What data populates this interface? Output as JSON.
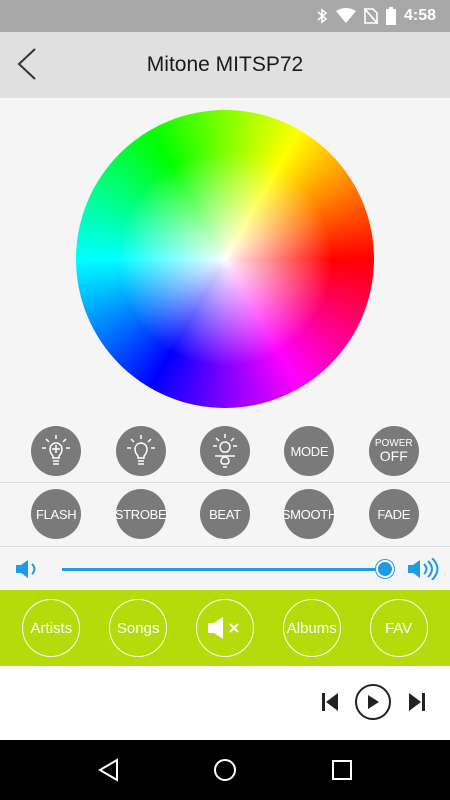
{
  "status_bar": {
    "time": "4:58",
    "icons": [
      "bluetooth-icon",
      "wifi-icon",
      "no-sim-icon",
      "battery-icon"
    ]
  },
  "header": {
    "title": "Mitone MITSP72",
    "back_icon": "chevron-left-icon"
  },
  "color_wheel": {
    "colors": [
      "#ff0000",
      "#ff00ff",
      "#0000ff",
      "#00ffff",
      "#00ff00",
      "#ffff00"
    ]
  },
  "controls_row1": [
    {
      "icon": "bulb-brightness-up-icon"
    },
    {
      "icon": "bulb-brightness-down-icon"
    },
    {
      "icon": "bulb-lamp-icon"
    },
    {
      "label": "MODE"
    },
    {
      "label_top": "POWER",
      "label_bottom": "OFF"
    }
  ],
  "controls_row2": [
    {
      "label": "FLASH"
    },
    {
      "label": "STROBE"
    },
    {
      "label": "BEAT"
    },
    {
      "label": "SMOOTH"
    },
    {
      "label": "FADE"
    }
  ],
  "volume": {
    "level": 0.99,
    "low_icon": "volume-low-icon",
    "high_icon": "volume-high-icon"
  },
  "music_bar": {
    "artists": "Artists",
    "songs": "Songs",
    "mute_icon": "mute-icon",
    "albums": "Albums",
    "fav": "FAV"
  },
  "player": {
    "prev_icon": "skip-previous-icon",
    "play_icon": "play-icon",
    "next_icon": "skip-next-icon"
  },
  "nav_bar": {
    "back_icon": "nav-back-icon",
    "home_icon": "nav-home-icon",
    "recents_icon": "nav-recents-icon"
  },
  "colors": {
    "accent_green": "#b5dc0a",
    "slider_blue": "#1e9ae6",
    "button_gray": "#7a7a7a"
  }
}
